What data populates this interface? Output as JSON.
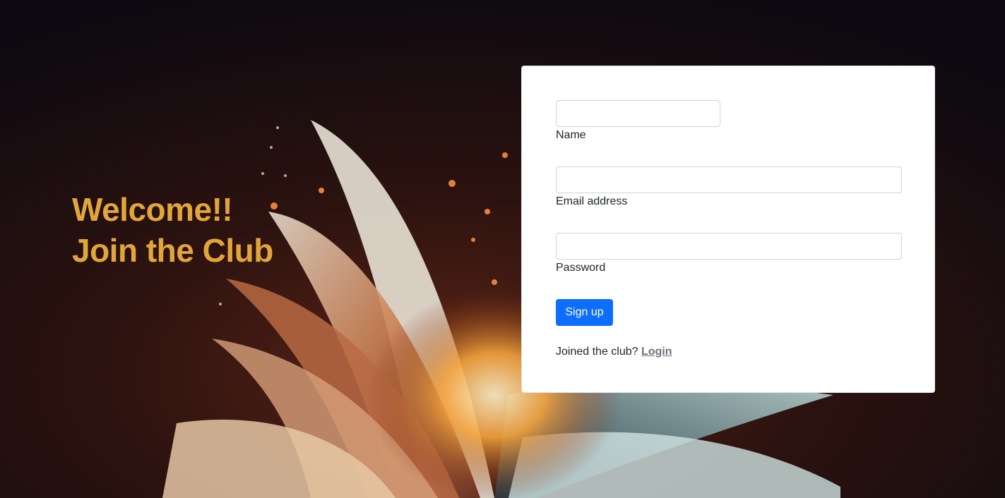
{
  "hero": {
    "line1": "Welcome!!",
    "line2": "Join the Club",
    "color": "#e2a53a"
  },
  "form": {
    "name": {
      "label": "Name",
      "value": "",
      "placeholder": ""
    },
    "email": {
      "label": "Email address",
      "value": "",
      "placeholder": ""
    },
    "password": {
      "label": "Password",
      "value": "",
      "placeholder": ""
    },
    "submit_label": "Sign up",
    "footer_text": "Joined the club?",
    "login_link": "Login",
    "accent": "#0d6efd"
  },
  "background": {
    "icon": "open-book-illustration"
  }
}
